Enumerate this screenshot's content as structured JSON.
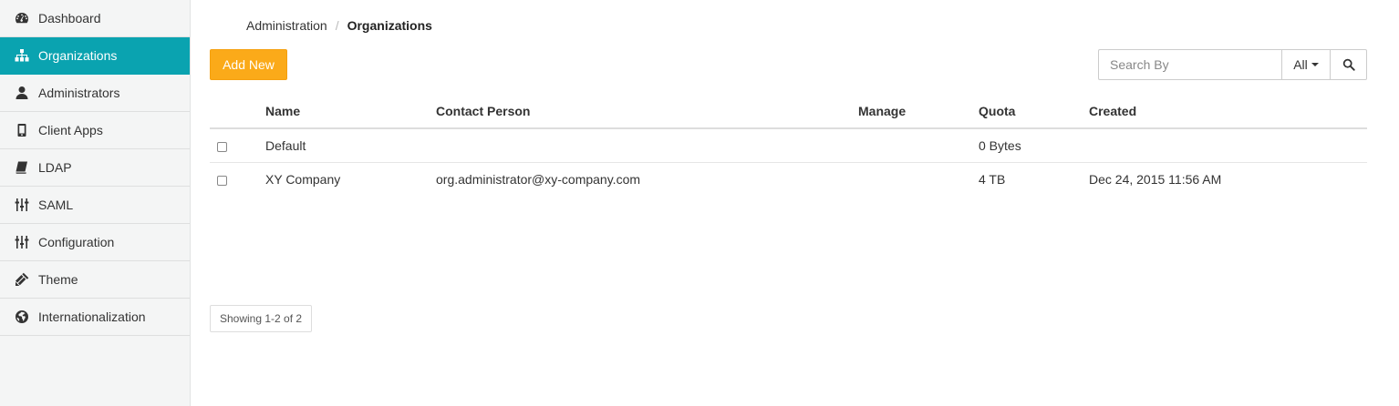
{
  "sidebar": {
    "items": [
      {
        "label": "Dashboard",
        "icon": "dashboard-icon",
        "active": false
      },
      {
        "label": "Organizations",
        "icon": "sitemap-icon",
        "active": true
      },
      {
        "label": "Administrators",
        "icon": "user-icon",
        "active": false
      },
      {
        "label": "Client Apps",
        "icon": "mobile-icon",
        "active": false
      },
      {
        "label": "LDAP",
        "icon": "book-icon",
        "active": false
      },
      {
        "label": "SAML",
        "icon": "sliders-icon",
        "active": false
      },
      {
        "label": "Configuration",
        "icon": "sliders-icon",
        "active": false
      },
      {
        "label": "Theme",
        "icon": "paint-icon",
        "active": false
      },
      {
        "label": "Internationalization",
        "icon": "globe-icon",
        "active": false
      }
    ]
  },
  "breadcrumb": {
    "parent": "Administration",
    "separator": "/",
    "current": "Organizations"
  },
  "toolbar": {
    "add_label": "Add New"
  },
  "search": {
    "placeholder": "Search By",
    "value": "",
    "filter_label": "All"
  },
  "table": {
    "headers": {
      "name": "Name",
      "contact": "Contact Person",
      "manage": "Manage",
      "quota": "Quota",
      "created": "Created"
    },
    "rows": [
      {
        "name": "Default",
        "contact": "",
        "manage": "",
        "quota": "0 Bytes",
        "created": "",
        "checked": false
      },
      {
        "name": "XY Company",
        "contact": "org.administrator@xy-company.com",
        "manage": "",
        "quota": "4 TB",
        "created": "Dec 24, 2015 11:56 AM",
        "checked": false
      }
    ]
  },
  "pagination": {
    "info": "Showing 1-2 of 2"
  },
  "colors": {
    "accent": "#0aa3b0",
    "add_button": "#fbaa19",
    "sidebar_bg": "#f4f5f5"
  }
}
